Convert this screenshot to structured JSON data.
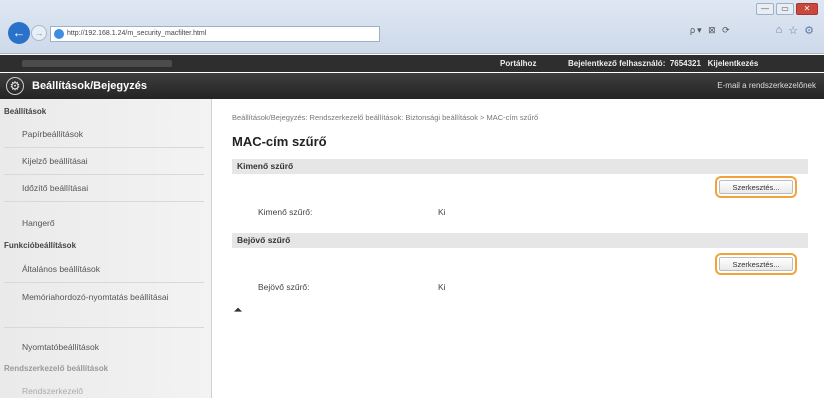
{
  "browser": {
    "address": "http://192.168.1.24/m_security_macfilter.html",
    "search_tools": "ρ▾ ⊠ ⟳",
    "win_min": "—",
    "win_max": "▭",
    "win_close": "✕",
    "icons": [
      "home-icon",
      "star-icon",
      "gear-icon"
    ]
  },
  "topbar": {
    "portal": "Portálhoz",
    "login_label": "Bejelentkező felhasználó:",
    "login_id": "7654321",
    "logout": "Kijelentkezés"
  },
  "titlebar": {
    "title": "Beállítások/Bejegyzés",
    "mail_link": "E-mail a rendszerkezelőnek"
  },
  "sidebar": {
    "section1": "Beállítások",
    "items1": [
      "Papírbeállítások",
      "Kijelző beállításai",
      "Időzítő beállításai",
      "Hangerő"
    ],
    "section2": "Funkcióbeállítások",
    "items2": [
      "Általános beállítások",
      "Memóriahordozó-nyomtatás beállításai",
      "Nyomtatóbeállítások"
    ],
    "section3": "Rendszerkezelő beállítások",
    "item3": "Rendszerkezelő"
  },
  "main": {
    "breadcrumb": "Beállítások/Bejegyzés: Rendszerkezelő beállítások: Biztonsági beállítások > MAC-cím szűrő",
    "page_title": "MAC-cím szűrő",
    "outgoing": {
      "header": "Kimenő szűrő",
      "edit": "Szerkesztés...",
      "label": "Kimenő szűrő:",
      "value": "Ki"
    },
    "incoming": {
      "header": "Bejövő szűrő",
      "edit": "Szerkesztés...",
      "label": "Bejövő szűrő:",
      "value": "Ki"
    },
    "top_link": "⏶"
  }
}
